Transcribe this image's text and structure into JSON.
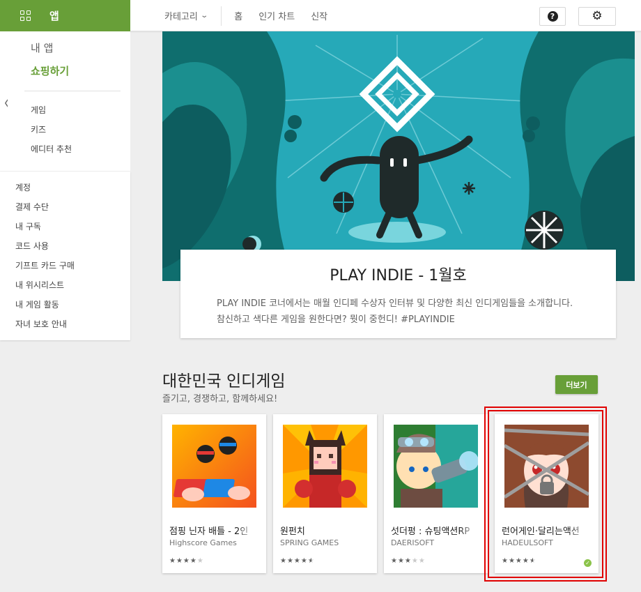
{
  "colors": {
    "accent": "#689f38",
    "banner_bg": "#26a9b8",
    "highlight": "#e00000"
  },
  "topbar": {
    "apps_label": "앱",
    "category_label": "카테고리",
    "nav": [
      "홈",
      "인기 차트",
      "신작"
    ],
    "help_icon": "help-icon",
    "settings_icon": "gear-icon"
  },
  "sidebar": {
    "my_apps": "내 앱",
    "shop": "쇼핑하기",
    "sub_items": [
      "게임",
      "키즈",
      "에디터 추천"
    ],
    "account_items": [
      "계정",
      "결제 수단",
      "내 구독",
      "코드 사용",
      "기프트 카드 구매",
      "내 위시리스트",
      "내 게임 활동",
      "자녀 보호 안내"
    ]
  },
  "banner": {
    "title": "PLAY INDIE - 1월호",
    "description": "PLAY INDIE 코너에서는 매월 인디페 수상자 인터뷰 및 다양한 최신 인디게임들을 소개합니다. 참신하고 색다른 게임을 원한다면? 뭣이 중헌디! #PLAYINDIE"
  },
  "section": {
    "title": "대한민국 인디게임",
    "subtitle": "즐기고, 경쟁하고, 함께하세요!",
    "more_label": "더보기"
  },
  "apps": [
    {
      "name": "점핑 닌자 배틀 - 2인",
      "developer": "Highscore Games",
      "rating": 4,
      "installed": false
    },
    {
      "name": "원펀치",
      "developer": "SPRING GAMES",
      "rating": 4.5,
      "installed": false
    },
    {
      "name": "섯더펑 : 슈팅액션RP",
      "developer": "DAERISOFT",
      "rating": 3,
      "installed": false
    },
    {
      "name": "런어게인·달리는액션",
      "developer": "HADEULSOFT",
      "rating": 4.5,
      "installed": true
    }
  ]
}
